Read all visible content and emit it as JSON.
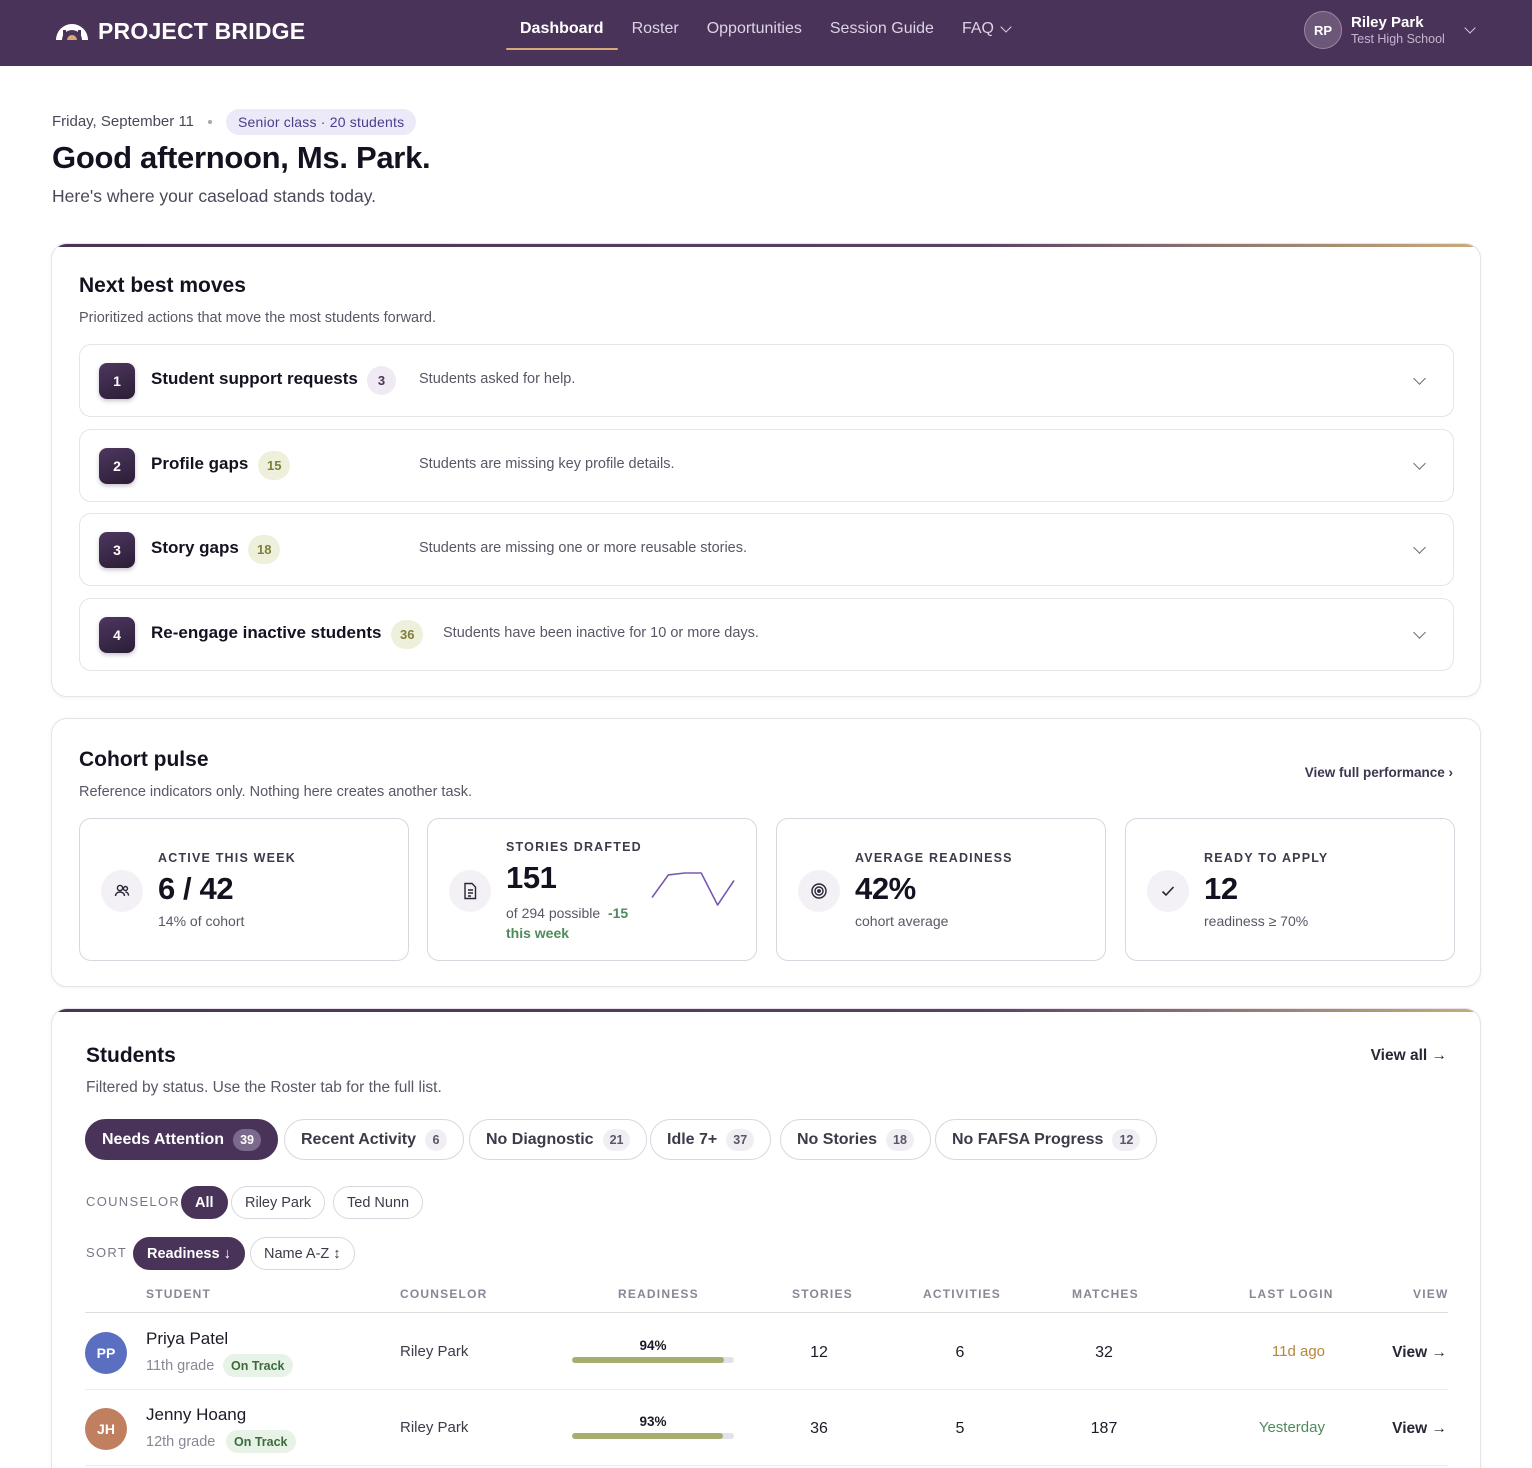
{
  "brand": {
    "name": "PROJECT BRIDGE"
  },
  "nav": {
    "items": [
      {
        "label": "Dashboard",
        "active": true
      },
      {
        "label": "Roster"
      },
      {
        "label": "Opportunities"
      },
      {
        "label": "Session Guide"
      },
      {
        "label": "FAQ"
      }
    ]
  },
  "user": {
    "initials": "RP",
    "name": "Riley Park",
    "school": "Test High School"
  },
  "header": {
    "date": "Friday, September 11",
    "class_pill": "Senior class · 20 students",
    "greeting": "Good afternoon, Ms. Park.",
    "subtitle": "Here's where your caseload stands today."
  },
  "next_moves": {
    "title": "Next best moves",
    "subtitle": "Prioritized actions that move the most students forward.",
    "items": [
      {
        "num": "1",
        "label": "Student support requests",
        "count": "3",
        "desc": "Students asked for help."
      },
      {
        "num": "2",
        "label": "Profile gaps",
        "count": "15",
        "desc": "Students are missing key profile details."
      },
      {
        "num": "3",
        "label": "Story gaps",
        "count": "18",
        "desc": "Students are missing one or more reusable stories."
      },
      {
        "num": "4",
        "label": "Re-engage inactive students",
        "count": "36",
        "desc": "Students have been inactive for 10 or more days."
      }
    ]
  },
  "cohort": {
    "title": "Cohort pulse",
    "subtitle": "Reference indicators only. Nothing here creates another task.",
    "view_link": "View full performance ›",
    "stats": [
      {
        "label": "ACTIVE THIS WEEK",
        "value": "6 / 42",
        "sub": "14% of cohort",
        "icon": "users-icon"
      },
      {
        "label": "STORIES DRAFTED",
        "value": "151",
        "sub": "of 294 possible",
        "delta": "-15 this week",
        "icon": "document-icon",
        "sparkline": [
          6,
          18,
          19,
          19,
          2,
          15
        ]
      },
      {
        "label": "AVERAGE READINESS",
        "value": "42%",
        "sub": "cohort average",
        "icon": "target-icon"
      },
      {
        "label": "READY TO APPLY",
        "value": "12",
        "sub": "readiness ≥ 70%",
        "icon": "check-icon"
      }
    ]
  },
  "students": {
    "title": "Students",
    "subtitle": "Filtered by status. Use the Roster tab for the full list.",
    "view_all": "View all →",
    "status_filters": [
      {
        "label": "Needs Attention",
        "count": "39",
        "active": true
      },
      {
        "label": "Recent Activity",
        "count": "6"
      },
      {
        "label": "No Diagnostic",
        "count": "21"
      },
      {
        "label": "Idle 7+",
        "count": "37"
      },
      {
        "label": "No Stories",
        "count": "18"
      },
      {
        "label": "No FAFSA Progress",
        "count": "12"
      }
    ],
    "counselor_label": "COUNSELOR",
    "counselor_filters": [
      {
        "label": "All",
        "active": true
      },
      {
        "label": "Riley Park"
      },
      {
        "label": "Ted Nunn"
      }
    ],
    "sort_label": "SORT",
    "sort_options": [
      {
        "label": "Readiness ↓",
        "active": true
      },
      {
        "label": "Name A-Z ↕"
      }
    ],
    "columns": {
      "student": "STUDENT",
      "counselor": "COUNSELOR",
      "readiness": "READINESS",
      "stories": "STORIES",
      "activities": "ACTIVITIES",
      "matches": "MATCHES",
      "last_login": "LAST LOGIN",
      "view": "VIEW"
    },
    "rows": [
      {
        "initials": "PP",
        "name": "Priya Patel",
        "grade": "11th grade",
        "status": "On Track",
        "counselor": "Riley Park",
        "readiness": "94%",
        "readiness_value": 94,
        "stories": "12",
        "activities": "6",
        "matches": "32",
        "last_login": "11d ago",
        "last_login_color": "#b5863a",
        "avatar_color": "#5a6fc0",
        "view": "View →"
      },
      {
        "initials": "JH",
        "name": "Jenny Hoang",
        "grade": "12th grade",
        "status": "On Track",
        "counselor": "Riley Park",
        "readiness": "93%",
        "readiness_value": 93,
        "stories": "36",
        "activities": "5",
        "matches": "187",
        "last_login": "Yesterday",
        "last_login_color": "#4f8a5c",
        "avatar_color": "#c07f5e",
        "view": "View →"
      }
    ]
  },
  "colors": {
    "nav_bg": "#4a3358",
    "accent": "#4a3358",
    "gold": "#d9a877",
    "readiness_bar": "#a6ad6f"
  }
}
